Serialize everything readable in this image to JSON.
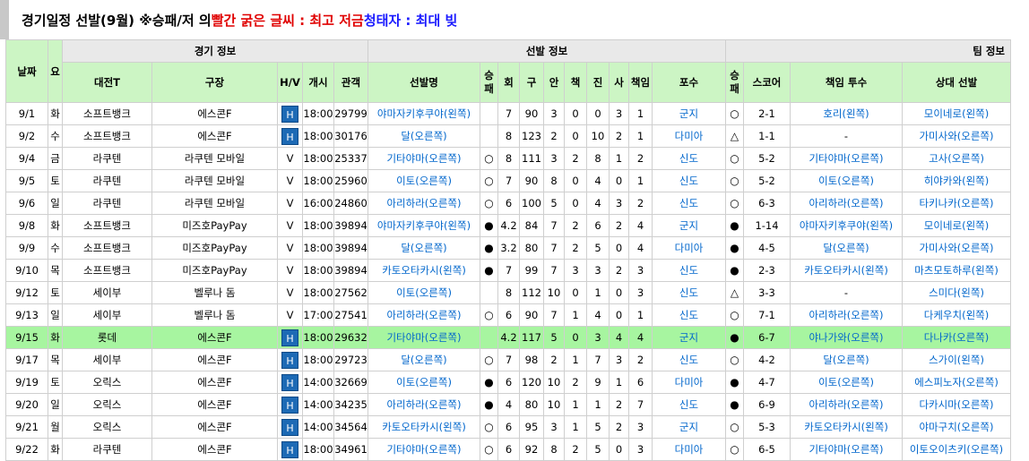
{
  "title": {
    "part1": "경기일정 선발(9월) ※승패/저 의 ",
    "red": "빨간 굵은 글씨 : 최고 저금",
    "part2": " ",
    "blue": "청태자 : 최대 빚"
  },
  "groups": {
    "game": "경기 정보",
    "starter": "선발 정보",
    "team": "팀 정보"
  },
  "columns": {
    "date": "날짜",
    "dow": "요",
    "opponent": "대전T",
    "stadium": "구장",
    "hv": "H/V",
    "start": "개시",
    "attendance": "관객",
    "starter": "선발명",
    "sp_result": "승\n패",
    "innings": "회",
    "pitches": "구",
    "hits": "안",
    "runs": "책",
    "k": "진",
    "bb": "사",
    "er": "책임",
    "catcher": "포수",
    "team_result": "승\n패",
    "score": "스코어",
    "resp_pitcher": "책임 투수",
    "opp_starter": "상대 선발"
  },
  "rows": [
    {
      "date": "9/1",
      "dow": "화",
      "opp": "소프트뱅크",
      "stadium": "에스콘F",
      "hv": "H",
      "start": "18:00",
      "att": "29799",
      "starter": "야마자키후쿠야(왼쪽)",
      "spres": "",
      "inn": "7",
      "pit": "90",
      "hits": "3",
      "runs": "0",
      "k": "0",
      "bb": "3",
      "er": "1",
      "catcher": "군지",
      "tres": "○",
      "score": "2-1",
      "resp": "호리(왼쪽)",
      "oppsp": "모이네로(왼쪽)"
    },
    {
      "date": "9/2",
      "dow": "수",
      "opp": "소프트뱅크",
      "stadium": "에스콘F",
      "hv": "H",
      "start": "18:00",
      "att": "30176",
      "starter": "달(오른쪽)",
      "spres": "",
      "inn": "8",
      "pit": "123",
      "hits": "2",
      "runs": "0",
      "k": "10",
      "bb": "2",
      "er": "1",
      "catcher": "다미아",
      "tres": "△",
      "score": "1-1",
      "resp": "-",
      "oppsp": "가미사와(오른쪽)"
    },
    {
      "date": "9/4",
      "dow": "금",
      "opp": "라쿠텐",
      "stadium": "라쿠텐 모바일",
      "hv": "V",
      "start": "18:00",
      "att": "25337",
      "starter": "기타야마(오른쪽)",
      "spres": "○",
      "inn": "8",
      "pit": "111",
      "hits": "3",
      "runs": "2",
      "k": "8",
      "bb": "1",
      "er": "2",
      "catcher": "신도",
      "tres": "○",
      "score": "5-2",
      "resp": "기타야마(오른쪽)",
      "oppsp": "고사(오른쪽)"
    },
    {
      "date": "9/5",
      "dow": "토",
      "opp": "라쿠텐",
      "stadium": "라쿠텐 모바일",
      "hv": "V",
      "start": "18:00",
      "att": "25960",
      "starter": "이토(오른쪽)",
      "spres": "○",
      "inn": "7",
      "pit": "90",
      "hits": "8",
      "runs": "0",
      "k": "4",
      "bb": "0",
      "er": "1",
      "catcher": "신도",
      "tres": "○",
      "score": "5-2",
      "resp": "이토(오른쪽)",
      "oppsp": "히야카와(왼쪽)"
    },
    {
      "date": "9/6",
      "dow": "일",
      "opp": "라쿠텐",
      "stadium": "라쿠텐 모바일",
      "hv": "V",
      "start": "16:00",
      "att": "24860",
      "starter": "아리하라(오른쪽)",
      "spres": "○",
      "inn": "6",
      "pit": "100",
      "hits": "5",
      "runs": "0",
      "k": "4",
      "bb": "3",
      "er": "2",
      "catcher": "신도",
      "tres": "○",
      "score": "6-3",
      "resp": "아리하라(오른쪽)",
      "oppsp": "타키나카(오른쪽)"
    },
    {
      "date": "9/8",
      "dow": "화",
      "opp": "소프트뱅크",
      "stadium": "미즈호PayPay",
      "hv": "V",
      "start": "18:00",
      "att": "39894",
      "starter": "야마자키후쿠야(왼쪽)",
      "spres": "●",
      "inn": "4.2",
      "pit": "84",
      "hits": "7",
      "runs": "2",
      "k": "6",
      "bb": "2",
      "er": "4",
      "catcher": "군지",
      "tres": "●",
      "score": "1-14",
      "resp": "야마자키후쿠야(왼쪽)",
      "oppsp": "모이네로(왼쪽)"
    },
    {
      "date": "9/9",
      "dow": "수",
      "opp": "소프트뱅크",
      "stadium": "미즈호PayPay",
      "hv": "V",
      "start": "18:00",
      "att": "39894",
      "starter": "달(오른쪽)",
      "spres": "●",
      "inn": "3.2",
      "pit": "80",
      "hits": "7",
      "runs": "2",
      "k": "5",
      "bb": "0",
      "er": "4",
      "catcher": "다미아",
      "tres": "●",
      "score": "4-5",
      "resp": "달(오른쪽)",
      "oppsp": "가미사와(오른쪽)"
    },
    {
      "date": "9/10",
      "dow": "목",
      "opp": "소프트뱅크",
      "stadium": "미즈호PayPay",
      "hv": "V",
      "start": "18:00",
      "att": "39894",
      "starter": "카토오타카시(왼쪽)",
      "spres": "●",
      "inn": "7",
      "pit": "99",
      "hits": "7",
      "runs": "3",
      "k": "3",
      "bb": "2",
      "er": "3",
      "catcher": "신도",
      "tres": "●",
      "score": "2-3",
      "resp": "카토오타카시(왼쪽)",
      "oppsp": "마츠모토하루(왼쪽)"
    },
    {
      "date": "9/12",
      "dow": "토",
      "opp": "세이부",
      "stadium": "벨루나 돔",
      "hv": "V",
      "start": "18:00",
      "att": "27562",
      "starter": "이토(오른쪽)",
      "spres": "",
      "inn": "8",
      "pit": "112",
      "hits": "10",
      "runs": "0",
      "k": "1",
      "bb": "0",
      "er": "3",
      "catcher": "신도",
      "tres": "△",
      "score": "3-3",
      "resp": "-",
      "oppsp": "스미다(왼쪽)"
    },
    {
      "date": "9/13",
      "dow": "일",
      "opp": "세이부",
      "stadium": "벨루나 돔",
      "hv": "V",
      "start": "17:00",
      "att": "27541",
      "starter": "아리하라(오른쪽)",
      "spres": "○",
      "inn": "6",
      "pit": "90",
      "hits": "7",
      "runs": "1",
      "k": "4",
      "bb": "0",
      "er": "1",
      "catcher": "신도",
      "tres": "○",
      "score": "7-1",
      "resp": "아리하라(오른쪽)",
      "oppsp": "다케우치(왼쪽)"
    },
    {
      "date": "9/15",
      "dow": "화",
      "opp": "롯데",
      "stadium": "에스콘F",
      "hv": "H",
      "start": "18:00",
      "att": "29632",
      "starter": "기타야마(오른쪽)",
      "spres": "",
      "inn": "4.2",
      "pit": "117",
      "hits": "5",
      "runs": "0",
      "k": "3",
      "bb": "4",
      "er": "4",
      "catcher": "군지",
      "tres": "●",
      "score": "6-7",
      "resp": "야나가와(오른쪽)",
      "oppsp": "다나카(오른쪽)",
      "hl": true
    },
    {
      "date": "9/17",
      "dow": "목",
      "opp": "세이부",
      "stadium": "에스콘F",
      "hv": "H",
      "start": "18:00",
      "att": "29723",
      "starter": "달(오른쪽)",
      "spres": "○",
      "inn": "7",
      "pit": "98",
      "hits": "2",
      "runs": "1",
      "k": "7",
      "bb": "3",
      "er": "2",
      "catcher": "신도",
      "tres": "○",
      "score": "4-2",
      "resp": "달(오른쪽)",
      "oppsp": "스가이(왼쪽)"
    },
    {
      "date": "9/19",
      "dow": "토",
      "opp": "오릭스",
      "stadium": "에스콘F",
      "hv": "H",
      "start": "14:00",
      "att": "32669",
      "starter": "이토(오른쪽)",
      "spres": "●",
      "inn": "6",
      "pit": "120",
      "hits": "10",
      "runs": "2",
      "k": "9",
      "bb": "1",
      "er": "6",
      "catcher": "다미아",
      "tres": "●",
      "score": "4-7",
      "resp": "이토(오른쪽)",
      "oppsp": "에스피노자(오른쪽)"
    },
    {
      "date": "9/20",
      "dow": "일",
      "opp": "오릭스",
      "stadium": "에스콘F",
      "hv": "H",
      "start": "14:00",
      "att": "34235",
      "starter": "아리하라(오른쪽)",
      "spres": "●",
      "inn": "4",
      "pit": "80",
      "hits": "10",
      "runs": "1",
      "k": "1",
      "bb": "2",
      "er": "7",
      "catcher": "신도",
      "tres": "●",
      "score": "6-9",
      "resp": "아리하라(오른쪽)",
      "oppsp": "다카시마(오른쪽)"
    },
    {
      "date": "9/21",
      "dow": "월",
      "opp": "오릭스",
      "stadium": "에스콘F",
      "hv": "H",
      "start": "14:00",
      "att": "34564",
      "starter": "카토오타카시(왼쪽)",
      "spres": "○",
      "inn": "6",
      "pit": "95",
      "hits": "3",
      "runs": "1",
      "k": "5",
      "bb": "2",
      "er": "3",
      "catcher": "군지",
      "tres": "○",
      "score": "5-3",
      "resp": "카토오타카시(왼쪽)",
      "oppsp": "야마구치(오른쪽)"
    },
    {
      "date": "9/22",
      "dow": "화",
      "opp": "라쿠텐",
      "stadium": "에스콘F",
      "hv": "H",
      "start": "18:00",
      "att": "34961",
      "starter": "기타야마(오른쪽)",
      "spres": "○",
      "inn": "6",
      "pit": "92",
      "hits": "8",
      "runs": "2",
      "k": "5",
      "bb": "0",
      "er": "3",
      "catcher": "다미아",
      "tres": "○",
      "score": "6-5",
      "resp": "기타야마(오른쪽)",
      "oppsp": "이토오이츠키(오른쪽)"
    }
  ]
}
